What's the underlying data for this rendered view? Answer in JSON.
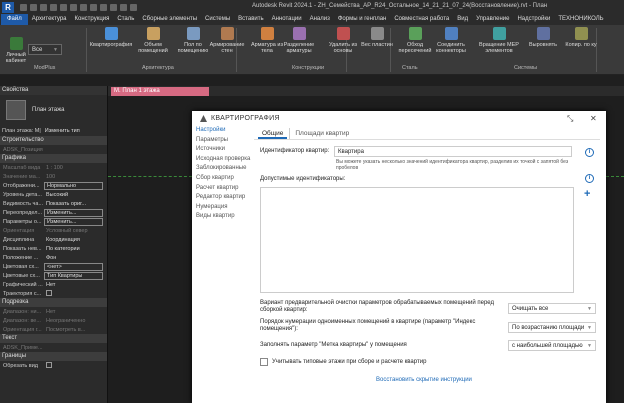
{
  "app": {
    "title": "Autodesk Revit 2024.1 - ZH_Семейства_AP_R24_Остальное_14_21_21_07_24(Восстановление).rvt - План",
    "logo": "R"
  },
  "menu": [
    "Файл",
    "Архитектура",
    "Конструкция",
    "Сталь",
    "Сборные элементы",
    "Системы",
    "Вставить",
    "Аннотации",
    "Анализ",
    "Формы и генплан",
    "Совместная работа",
    "Вид",
    "Управление",
    "Надстройки",
    "ТЕХНОНИКОЛЬ"
  ],
  "ribbon": {
    "left_items": [
      {
        "label": "Личный кабинет"
      },
      {
        "label": "Все"
      }
    ],
    "buttons": [
      {
        "label": "Квартирография",
        "color": "#4a90d9"
      },
      {
        "label": "Объем помещений",
        "color": "#c8a060"
      },
      {
        "label": "Пол по помещению",
        "color": "#7a9ac0"
      },
      {
        "label": "Армирование стен",
        "color": "#b07a50"
      },
      {
        "label": "Арматура из тела",
        "color": "#d08040"
      },
      {
        "label": "Разделение арматуры",
        "color": "#9a70b0"
      },
      {
        "label": "Удалить из основы",
        "color": "#c05050"
      },
      {
        "label": "Вес пластин",
        "color": "#8a8a8a"
      },
      {
        "label": "Обход пересечений",
        "color": "#5aa05a"
      },
      {
        "label": "Соединить коннекторы",
        "color": "#5080c0"
      },
      {
        "label": "Вращение MEP элементов",
        "color": "#40a0a0"
      },
      {
        "label": "Выровнять",
        "color": "#6070a0"
      },
      {
        "label": "Копир. по ку",
        "color": "#909050"
      }
    ],
    "groups": [
      "ModPlus",
      "Архитектура",
      "Конструкции",
      "Сталь",
      "Системы"
    ]
  },
  "properties": {
    "title": "Свойства",
    "type_name": "План этажа",
    "selector": "План этажа: M|",
    "edit_type": "Изменить тип",
    "rows": [
      {
        "cat": "Строительство"
      },
      {
        "k": "ADSK_Позиция",
        "v": "",
        "dim": true
      },
      {
        "cat": "Графика"
      },
      {
        "k": "Масштаб вида",
        "v": "1 : 100",
        "dim": true
      },
      {
        "k": "Значение ма...",
        "v": "100",
        "dim": true
      },
      {
        "k": "Отображени...",
        "v": "Нормально",
        "box": true
      },
      {
        "k": "Уровень дета...",
        "v": "Высокий"
      },
      {
        "k": "Видимость ча...",
        "v": "Показать ориг..."
      },
      {
        "k": "Переопредел...",
        "v": "Изменить...",
        "box": true
      },
      {
        "k": "Параметры о...",
        "v": "Изменить...",
        "box": true
      },
      {
        "k": "Ориентация",
        "v": "Условный север",
        "dim": true
      },
      {
        "k": "Дисциплина",
        "v": "Координация"
      },
      {
        "k": "Показать нев...",
        "v": "По категории"
      },
      {
        "k": "Положение ...",
        "v": "Фон"
      },
      {
        "k": "Цветовая сх...",
        "v": "<нет>",
        "box": true
      },
      {
        "k": "Цветовые сх...",
        "v": "Тип Квартиры",
        "box": true
      },
      {
        "k": "Графический ...",
        "v": "Нет"
      },
      {
        "k": "Траектория с...",
        "v": "",
        "check": true
      },
      {
        "cat": "Подрезка"
      },
      {
        "k": "Диапазон: ни...",
        "v": "Нет",
        "dim": true
      },
      {
        "k": "Диапазон: ве...",
        "v": "Неограниченно",
        "dim": true
      },
      {
        "k": "Ориентация г...",
        "v": "Посмотреть в...",
        "dim": true
      },
      {
        "cat": "Текст"
      },
      {
        "k": "ADSK_Приме...",
        "v": "",
        "dim": true
      },
      {
        "cat": "Границы"
      },
      {
        "k": "Обрезать вид",
        "v": "",
        "check": true
      }
    ]
  },
  "view_tab": {
    "label": "M. План 1 этажа"
  },
  "dialog": {
    "title": "КВАРТИРОГРАФИЯ",
    "nav": [
      "Настройки",
      "Параметры",
      "Источники",
      "Исходная проверка",
      "Заблокированные",
      "Сбор квартир",
      "Расчет квартир",
      "Редактор квартир",
      "Нумерация",
      "Виды квартир"
    ],
    "nav_active": 0,
    "tabs": [
      "Общие",
      "Площади квартир"
    ],
    "tab_active": 0,
    "id_label": "Идентификатор квартир:",
    "id_value": "Квартира",
    "id_hint": "Вы можете указать несколько значений идентификатора квартир, разделив их точкой с запятой без пробелов",
    "allowed_label": "Допустимые идентификаторы:",
    "preclean_label": "Вариант предварительной очистки параметров обрабатываемых помещений перед сборкой квартир:",
    "preclean_value": "Очищать все",
    "order_label": "Порядок нумерации одноименных помещений в квартире (параметр \"Индекс помещения\"):",
    "order_value": "По возрастанию площади",
    "mark_label": "Заполнять параметр \"Метка квартиры\" у помещения",
    "mark_value": "с наибольшей площадью",
    "typical_label": "Учитывать типовые этажи при сборе и расчете квартир",
    "restore_link": "Восстановить скрытие инструкции",
    "info_glyph": "i",
    "plus_glyph": "+"
  },
  "colors": {
    "accent": "#1e6ab7",
    "tab": "#d66a82",
    "brand": "#1e5aa8"
  }
}
